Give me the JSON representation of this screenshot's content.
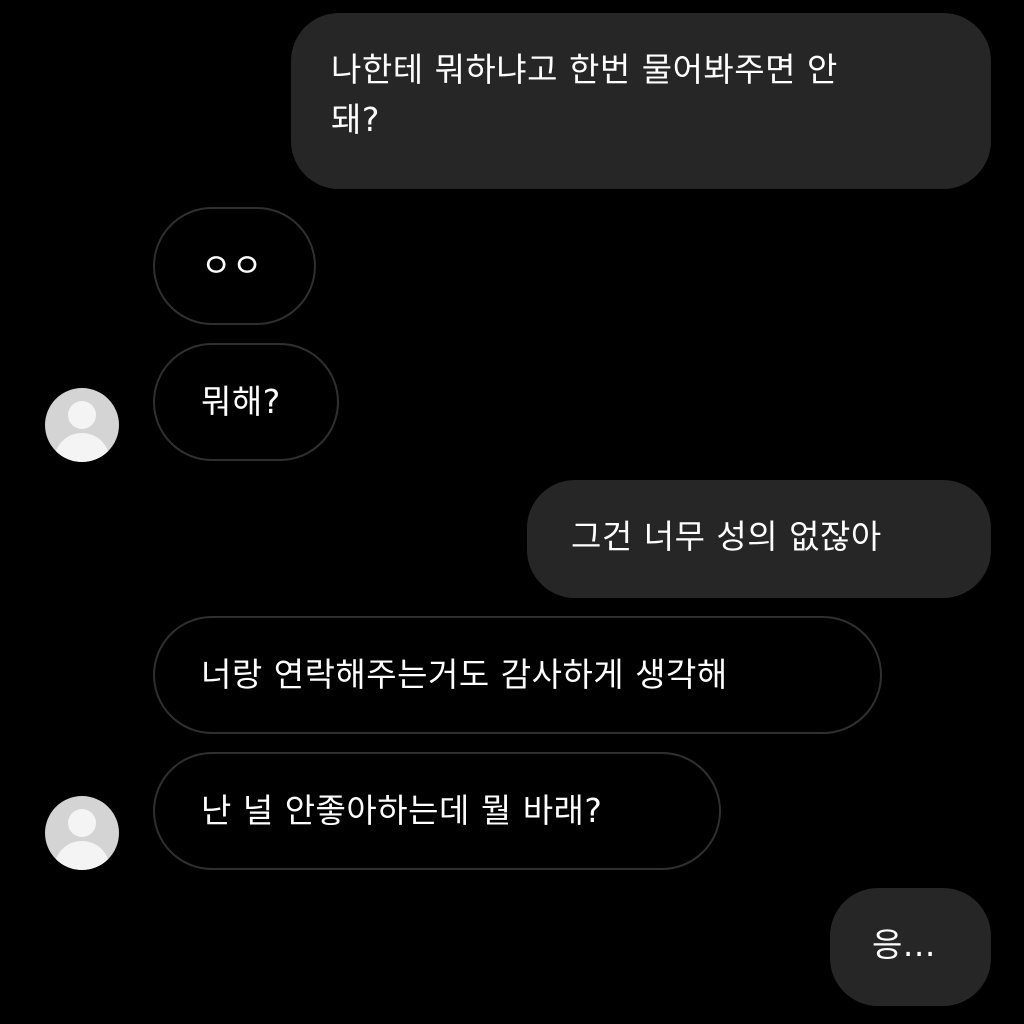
{
  "theme": {
    "background": "#000000",
    "sent_bubble_color": "#262626",
    "received_bubble_border": "#2f2f2f",
    "text_color": "#ffffff"
  },
  "messages": [
    {
      "sender": "me",
      "lines": [
        "나한테 뭐하냐고 한번 물어봐주면 안",
        "돼?"
      ]
    },
    {
      "sender": "other",
      "text": "ㅇㅇ"
    },
    {
      "sender": "other",
      "text": "뭐해?"
    },
    {
      "sender": "me",
      "text": "그건 너무 성의 없잖아"
    },
    {
      "sender": "other",
      "text": "너랑 연락해주는거도 감사하게 생각해"
    },
    {
      "sender": "other",
      "text": "난 널 안좋아하는데 뭘 바래?"
    },
    {
      "sender": "me",
      "text": "응..."
    }
  ],
  "avatars": [
    {
      "icon": "default-profile-icon"
    },
    {
      "icon": "default-profile-icon"
    }
  ]
}
